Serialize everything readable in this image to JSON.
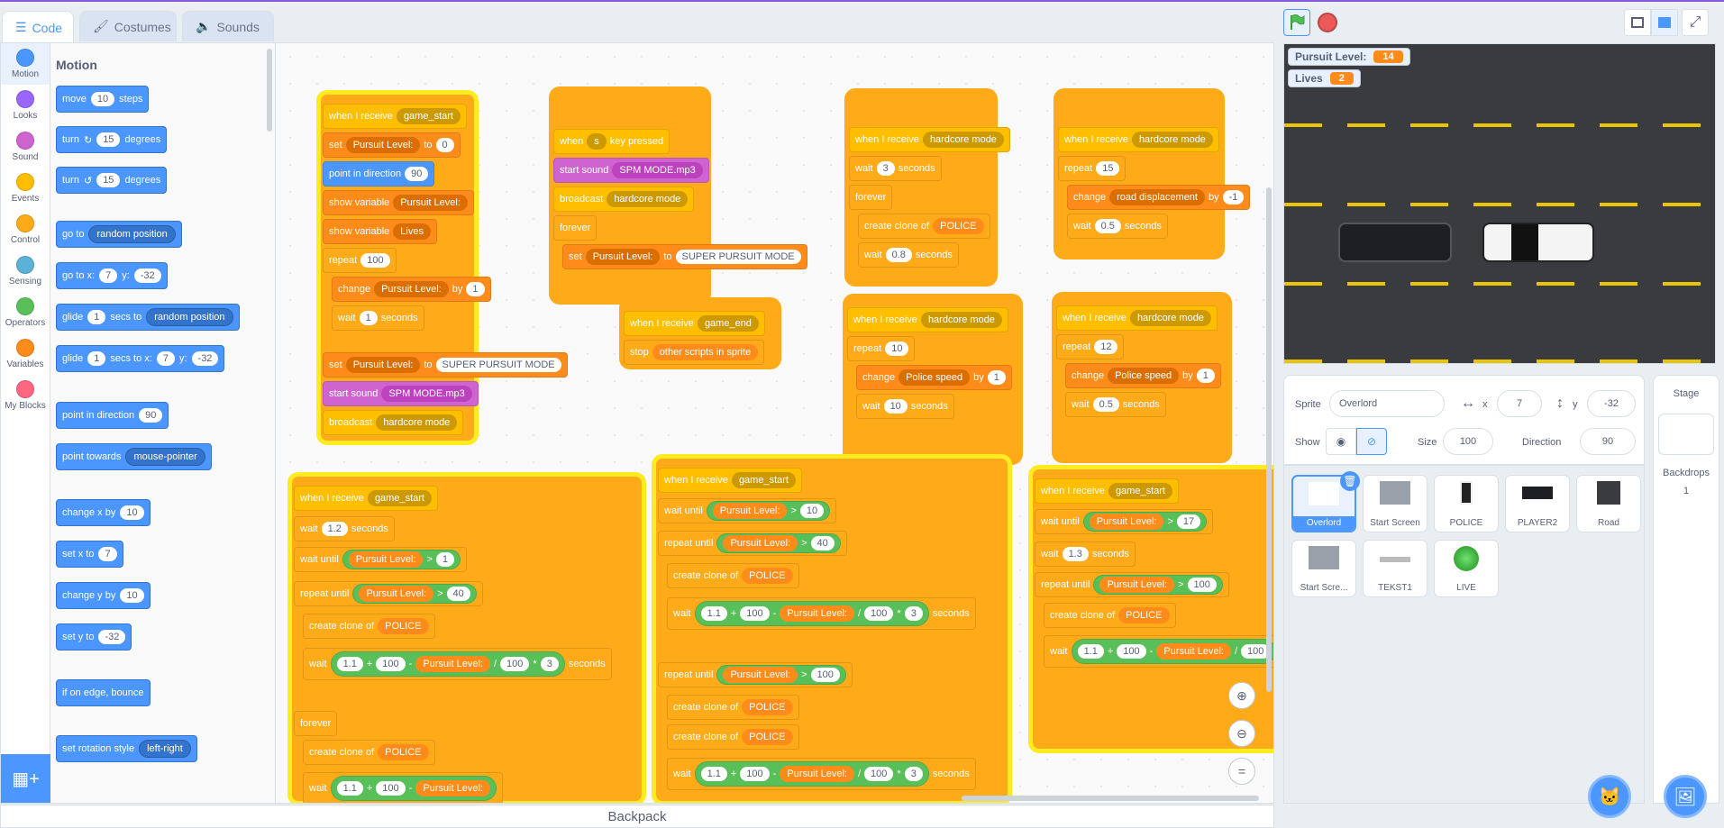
{
  "tabs": [
    {
      "label": "Code",
      "icon": "code-icon"
    },
    {
      "label": "Costumes",
      "icon": "brush-icon"
    },
    {
      "label": "Sounds",
      "icon": "speaker-icon"
    }
  ],
  "categories": [
    {
      "label": "Motion",
      "color": "#4c97ff"
    },
    {
      "label": "Looks",
      "color": "#9966ff"
    },
    {
      "label": "Sound",
      "color": "#cf63cf"
    },
    {
      "label": "Events",
      "color": "#ffbf00"
    },
    {
      "label": "Control",
      "color": "#ffab19"
    },
    {
      "label": "Sensing",
      "color": "#5cb1d6"
    },
    {
      "label": "Operators",
      "color": "#59c059"
    },
    {
      "label": "Variables",
      "color": "#ff8c1a"
    },
    {
      "label": "My Blocks",
      "color": "#ff6680"
    }
  ],
  "palette": {
    "title": "Motion",
    "move": {
      "a": "move",
      "v": "10",
      "b": "steps"
    },
    "turn_cw": {
      "a": "turn",
      "v": "15",
      "b": "degrees"
    },
    "turn_ccw": {
      "a": "turn",
      "v": "15",
      "b": "degrees"
    },
    "goto": {
      "a": "go to",
      "d": "random position"
    },
    "gotoxy": {
      "a": "go to x:",
      "x": "7",
      "b": "y:",
      "y": "-32"
    },
    "glide1": {
      "a": "glide",
      "v": "1",
      "b": "secs to",
      "d": "random position"
    },
    "glide2": {
      "a": "glide",
      "v": "1",
      "b": "secs to x:",
      "x": "7",
      "c": "y:",
      "y": "-32"
    },
    "pointdir": {
      "a": "point in direction",
      "v": "90"
    },
    "pointtowards": {
      "a": "point towards",
      "d": "mouse-pointer"
    },
    "changex": {
      "a": "change x by",
      "v": "10"
    },
    "setx": {
      "a": "set x to",
      "v": "7"
    },
    "changey": {
      "a": "change y by",
      "v": "10"
    },
    "sety": {
      "a": "set y to",
      "v": "-32"
    },
    "bounce": {
      "a": "if on edge, bounce"
    },
    "rotstyle": {
      "a": "set rotation style",
      "d": "left-right"
    }
  },
  "s": {
    "when_receive": "when I receive",
    "game_start": "game_start",
    "game_end": "game_end",
    "hardcore": "hardcore mode",
    "set": "set",
    "to": "to",
    "pursuit": "Pursuit Level:",
    "lives": "Lives",
    "zero": "0",
    "point_dir": "point in direction",
    "ninety": "90",
    "show_var": "show variable",
    "repeat": "repeat",
    "repeat_until": "repeat until",
    "forever": "forever",
    "change": "change",
    "by": "by",
    "one": "1",
    "wait": "wait",
    "seconds": "seconds",
    "wait_until": "wait until",
    "super": "SUPER PURSUIT MODE",
    "start_sound": "start sound",
    "spm": "SPM MODE.mp3",
    "broadcast": "broadcast",
    "when": "when",
    "key_s": "s",
    "key_pressed": "key pressed",
    "stop": "stop",
    "other_scripts": "other scripts in sprite",
    "create_clone": "create clone of",
    "police": "POLICE",
    "police_speed": "Police speed",
    "road_disp": "road displacement",
    "neg1": "-1",
    "n100": "100",
    "n3": "3",
    "n0_8": "0.8",
    "n15": "15",
    "n0_5": "0.5",
    "n10": "10",
    "n12": "12",
    "n1_2": "1.2",
    "n40": "40",
    "n1_1": "1.1",
    "n17": "17",
    "n1_3": "1.3",
    "plus": "+",
    "minus": "-",
    "div": "/",
    "mul": "*",
    "gt": ">"
  },
  "backpack": "Backpack",
  "stage": {
    "monitors": [
      {
        "label": "Pursuit Level:",
        "value": "14"
      },
      {
        "label": "Lives",
        "value": "2"
      }
    ]
  },
  "sprite_info": {
    "sprite_label": "Sprite",
    "sprite_name": "Overlord",
    "x_label": "x",
    "x_value": "7",
    "y_label": "y",
    "y_value": "-32",
    "show_label": "Show",
    "size_label": "Size",
    "size_value": "100",
    "direction_label": "Direction",
    "direction_value": "90"
  },
  "sprites": [
    "Overlord",
    "Start Screen",
    "POLICE",
    "PLAYER2",
    "Road",
    "Start Scre...",
    "TEKST1",
    "LIVE"
  ],
  "stage_panel": {
    "title": "Stage",
    "backdrops_label": "Backdrops",
    "backdrops_count": "1"
  }
}
